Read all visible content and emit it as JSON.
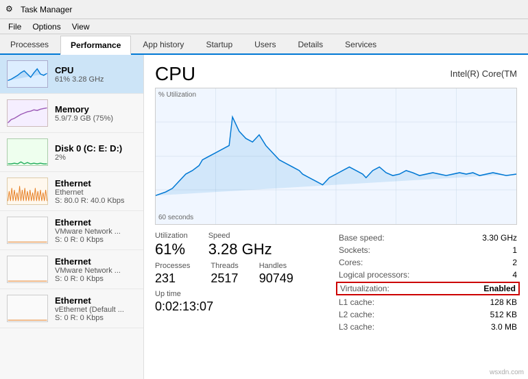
{
  "titleBar": {
    "icon": "⚙",
    "title": "Task Manager"
  },
  "menuBar": {
    "items": [
      "File",
      "Options",
      "View"
    ]
  },
  "tabs": [
    {
      "label": "Processes",
      "active": false
    },
    {
      "label": "Performance",
      "active": true
    },
    {
      "label": "App history",
      "active": false
    },
    {
      "label": "Startup",
      "active": false
    },
    {
      "label": "Users",
      "active": false
    },
    {
      "label": "Details",
      "active": false
    },
    {
      "label": "Services",
      "active": false
    }
  ],
  "sidebar": {
    "items": [
      {
        "name": "CPU",
        "subtitle1": "61%  3.28 GHz",
        "type": "cpu",
        "active": true
      },
      {
        "name": "Memory",
        "subtitle1": "5.9/7.9 GB (75%)",
        "type": "memory",
        "active": false
      },
      {
        "name": "Disk 0 (C: E: D:)",
        "subtitle1": "2%",
        "type": "disk",
        "active": false
      },
      {
        "name": "Ethernet",
        "subtitle1": "Ethernet",
        "subtitle2": "S: 80.0  R: 40.0 Kbps",
        "type": "ethernet",
        "active": false
      },
      {
        "name": "Ethernet",
        "subtitle1": "VMware Network ...",
        "subtitle2": "S: 0  R: 0 Kbps",
        "type": "ethernet",
        "active": false
      },
      {
        "name": "Ethernet",
        "subtitle1": "VMware Network ...",
        "subtitle2": "S: 0  R: 0 Kbps",
        "type": "ethernet",
        "active": false
      },
      {
        "name": "Ethernet",
        "subtitle1": "vEthernet (Default ...",
        "subtitle2": "S: 0  R: 0 Kbps",
        "type": "ethernet",
        "active": false
      }
    ]
  },
  "panel": {
    "title": "CPU",
    "processorName": "Intel(R) Core(TM",
    "chartLabelY": "% Utilization",
    "chartLabelX": "60 seconds",
    "stats": {
      "utilizationLabel": "Utilization",
      "utilizationValue": "61%",
      "speedLabel": "Speed",
      "speedValue": "3.28 GHz",
      "processesLabel": "Processes",
      "processesValue": "231",
      "threadsLabel": "Threads",
      "threadsValue": "2517",
      "handlesLabel": "Handles",
      "handlesValue": "90749",
      "uptimeLabel": "Up time",
      "uptimeValue": "0:02:13:07"
    },
    "info": {
      "baseSpeedLabel": "Base speed:",
      "baseSpeedValue": "3.30 GHz",
      "socketsLabel": "Sockets:",
      "socketsValue": "1",
      "coresLabel": "Cores:",
      "coresValue": "2",
      "logicalLabel": "Logical processors:",
      "logicalValue": "4",
      "virtLabel": "Virtualization:",
      "virtValue": "Enabled",
      "l1Label": "L1 cache:",
      "l1Value": "128 KB",
      "l2Label": "L2 cache:",
      "l2Value": "512 KB",
      "l3Label": "L3 cache:",
      "l3Value": "3.0 MB"
    }
  },
  "watermark": "wsxdn.com"
}
